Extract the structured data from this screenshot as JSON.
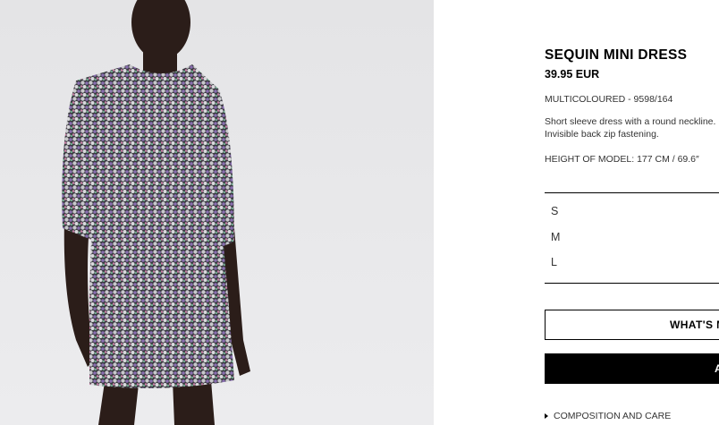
{
  "product": {
    "name": "SEQUIN MINI DRESS",
    "price": "39.95 EUR",
    "color_ref": "MULTICOLOURED - 9598/164",
    "description": "Short sleeve dress with a round neckline. Lined. Invisible back zip fastening.",
    "model_height": "HEIGHT OF MODEL: 177 CM / 69.6″"
  },
  "sizes": [
    "S",
    "M",
    "L"
  ],
  "buttons": {
    "size_guide": "WHAT'S MY SIZE?",
    "add": "ADD"
  },
  "composition_label": "COMPOSITION AND CARE",
  "photo": {
    "icon": "product-photo",
    "background": "#e6e6e8"
  }
}
